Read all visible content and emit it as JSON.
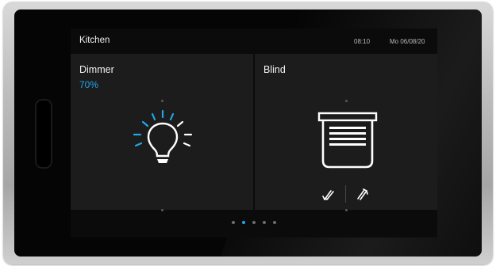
{
  "header": {
    "title": "Kitchen",
    "time": "08:10",
    "date": "Mo 06/08/20"
  },
  "tiles": [
    {
      "name": "Dimmer",
      "value": "70%",
      "icon": "lightbulb-icon"
    },
    {
      "name": "Blind",
      "icon": "blind-icon",
      "controls": [
        "blind-down-icon",
        "blind-up-icon"
      ]
    }
  ],
  "pager": {
    "pages": 5,
    "active": 2
  },
  "colors": {
    "accent": "#1fa7e8",
    "tile": "#1c1c1c",
    "background": "#0b0b0b"
  }
}
